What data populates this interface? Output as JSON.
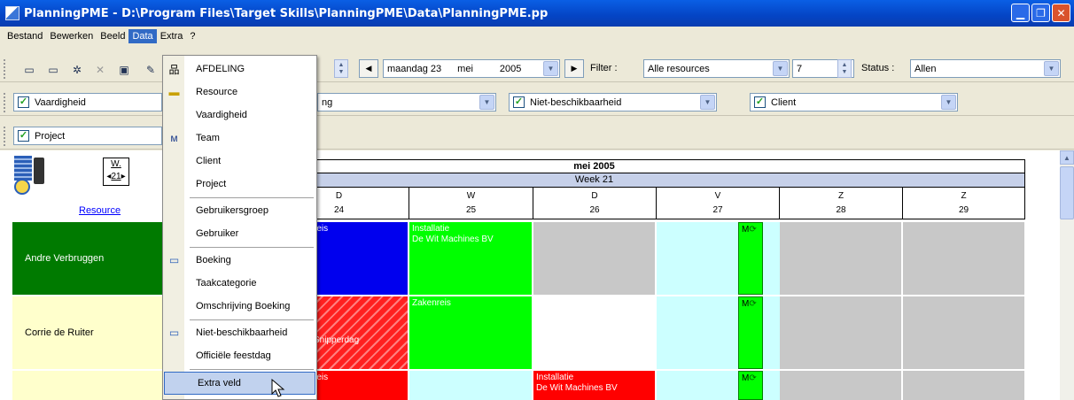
{
  "window": {
    "title": "PlanningPME - D:\\Program Files\\Target Skills\\PlanningPME\\Data\\PlanningPME.pp"
  },
  "menubar": [
    "Bestand",
    "Bewerken",
    "Beeld",
    "Data",
    "Extra",
    "?"
  ],
  "toolbar1": {
    "date_day": "maandag 23",
    "date_month": "mei",
    "date_year": "2005",
    "filter_label": "Filter :",
    "filter_value": "Alle resources",
    "days_value": "7",
    "status_label": "Status :",
    "status_value": "Allen"
  },
  "toolbar2": {
    "vaardigheid": "Vaardigheid",
    "partial": "ng",
    "niet_beschikbaarheid": "Niet-beschikbaarheid",
    "client": "Client"
  },
  "toolbar3": {
    "project": "Project"
  },
  "dropdown": [
    {
      "label": "AFDELING",
      "icon": "hierarchy-icon"
    },
    {
      "label": "Resource",
      "icon": "person-icon"
    },
    {
      "label": "Vaardigheid",
      "icon": ""
    },
    {
      "label": "Team",
      "icon": "team-icon"
    },
    {
      "label": "Client",
      "icon": ""
    },
    {
      "label": "Project",
      "icon": ""
    },
    {
      "label": "Gebruikersgroep",
      "icon": ""
    },
    {
      "label": "Gebruiker",
      "icon": ""
    },
    {
      "label": "Boeking",
      "icon": "booking-icon"
    },
    {
      "label": "Taakcategorie",
      "icon": ""
    },
    {
      "label": "Omschrijving Boeking",
      "icon": ""
    },
    {
      "label": "Niet-beschikbaarheid",
      "icon": "unavailable-icon"
    },
    {
      "label": "Officiële feestdag",
      "icon": ""
    },
    {
      "label": "Extra veld",
      "icon": ""
    }
  ],
  "planner": {
    "month": "mei 2005",
    "week": "Week 21",
    "week_button_top": "W.",
    "week_button_num": "21",
    "resource_link": "Resource",
    "days": [
      {
        "letter": "D",
        "num": "24"
      },
      {
        "letter": "W",
        "num": "25"
      },
      {
        "letter": "D",
        "num": "26"
      },
      {
        "letter": "V",
        "num": "27"
      },
      {
        "letter": "Z",
        "num": "28"
      },
      {
        "letter": "Z",
        "num": "29"
      }
    ],
    "resources": [
      "Andre Verbruggen",
      "Corrie de Ruiter",
      ""
    ],
    "cells": {
      "r1_d24": "reis",
      "r1_d25_line1": "Installatie",
      "r1_d25_line2": "De Wit Machines BV",
      "r2_d24": "Snipperdag",
      "r2_d25": "Zakenreis",
      "r3_d24": "reis",
      "r3_d26_line1": "Installatie",
      "r3_d26_line2": "De Wit Machines BV",
      "m1": "M",
      "m2": "M",
      "m3": "M"
    }
  }
}
